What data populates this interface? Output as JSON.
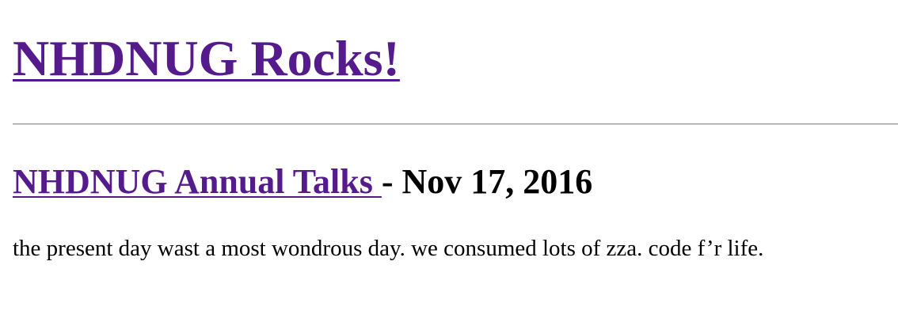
{
  "site": {
    "title": "NHDNUG Rocks!"
  },
  "post": {
    "title_link": "NHDNUG Annual Talks ",
    "date_separator": "- Nov 17, 2016",
    "body": "the present day wast a most wondrous day. we consumed lots of zza. code f’r life."
  },
  "colors": {
    "link_visited": "#551a8b",
    "text": "#000000",
    "background": "#ffffff"
  }
}
